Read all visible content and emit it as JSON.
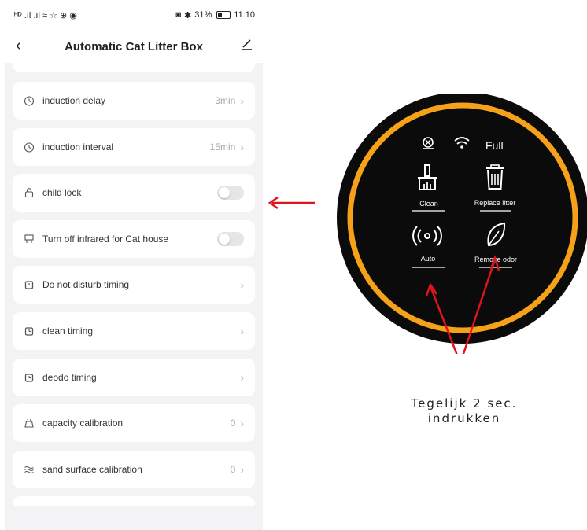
{
  "status_bar": {
    "left_text": "ᴴᴰ .ıl .ıl ≈ ☆ ⊕ ◉",
    "battery_text": "31%",
    "time": "11:10"
  },
  "header": {
    "title": "Automatic Cat Litter Box"
  },
  "settings": [
    {
      "label": "induction delay",
      "value": "3min",
      "icon": "timer-icon"
    },
    {
      "label": "induction interval",
      "value": "15min",
      "icon": "timer-icon"
    },
    {
      "label": "child lock",
      "toggle": false,
      "icon": "lock-icon"
    },
    {
      "label": "Turn off infrared for Cat house",
      "toggle": false,
      "icon": "cat-house-icon"
    },
    {
      "label": "Do not disturb timing",
      "icon": "alarm-clock-icon"
    },
    {
      "label": "clean timing",
      "icon": "alarm-clock-icon"
    },
    {
      "label": "deodo timing",
      "icon": "alarm-clock-icon"
    },
    {
      "label": "capacity calibration",
      "value": "0",
      "icon": "capacity-icon"
    },
    {
      "label": "sand surface calibration",
      "value": "0",
      "icon": "wave-icon"
    }
  ],
  "device_panel": {
    "status_label": "Full",
    "buttons": {
      "clean": "Clean",
      "replace_litter": "Replace litter",
      "auto": "Auto",
      "remove_odor": "Remove odor"
    },
    "colors": {
      "ring": "#f5a21a",
      "face": "#0b0b0b",
      "arrow": "#e0141e"
    }
  },
  "caption": {
    "line1": "Tegelijk 2 sec.",
    "line2": "indrukken"
  }
}
